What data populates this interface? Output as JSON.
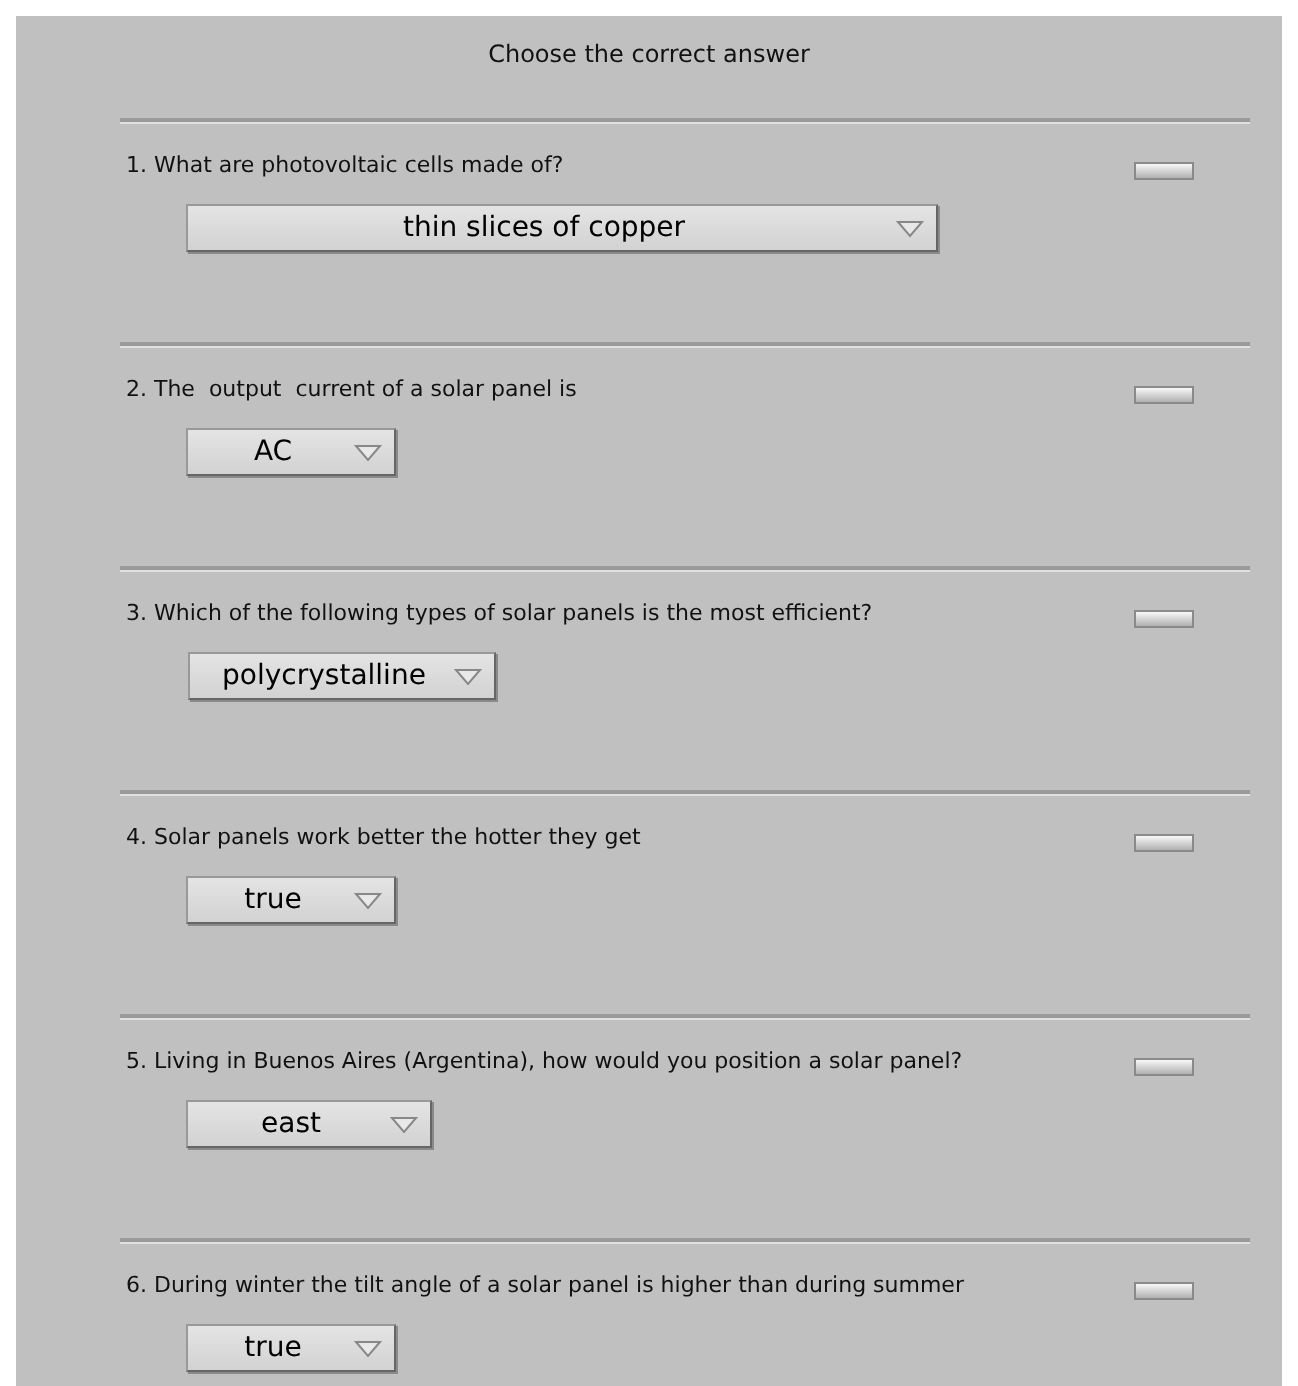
{
  "title": "Choose the correct answer",
  "questions": [
    {
      "prompt": "1. What are photovoltaic cells made of?",
      "answer": "thin slices of copper"
    },
    {
      "prompt": "2. The  output  current of a solar panel is",
      "answer": "AC"
    },
    {
      "prompt": "3. Which of the following types of solar panels is the most efficient?",
      "answer": "polycrystalline"
    },
    {
      "prompt": "4. Solar panels work better the hotter they get",
      "answer": "true"
    },
    {
      "prompt": "5. Living in Buenos Aires (Argentina), how would you position a solar panel?",
      "answer": "east"
    },
    {
      "prompt": "6. During winter the tilt angle of a solar panel is higher than during summer",
      "answer": "true"
    }
  ]
}
